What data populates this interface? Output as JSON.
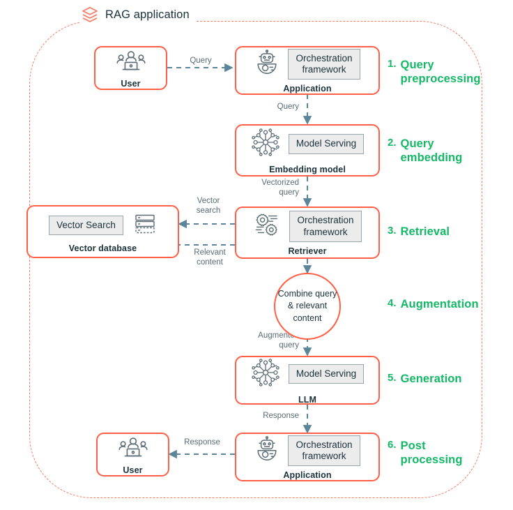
{
  "diagram": {
    "title": "RAG application",
    "title_icon": "layers-icon",
    "boundary_style": "dashed-rounded",
    "colors": {
      "node_border": "#ff5f46",
      "boundary": "#f4664a",
      "step_label": "#14b866",
      "arrow": "#5b8699",
      "chip_fill": "#ececec",
      "text": "#1b3139",
      "edge_label": "#5a6b73"
    }
  },
  "nodes": {
    "user_top": {
      "label": "User",
      "icon": "users-group-icon"
    },
    "application_top": {
      "label": "Application",
      "icon": "robot-icon",
      "chip": "Orchestration\nframework"
    },
    "embedding_model": {
      "label": "Embedding model",
      "icon": "neural-network-icon",
      "chip": "Model Serving"
    },
    "vector_database": {
      "label": "Vector database",
      "icon": "database-stack-icon",
      "chip": "Vector Search"
    },
    "retriever": {
      "label": "Retriever",
      "icon": "gears-icon",
      "chip": "Orchestration\nframework"
    },
    "combine": {
      "text": "Combine\nquery &\nrelevant\ncontent"
    },
    "llm": {
      "label": "LLM",
      "icon": "neural-network-icon",
      "chip": "Model Serving"
    },
    "application_bottom": {
      "label": "Application",
      "icon": "robot-icon",
      "chip": "Orchestration\nframework"
    },
    "user_bottom": {
      "label": "User",
      "icon": "users-group-icon"
    }
  },
  "edges": {
    "user_to_app": "Query",
    "app_to_embedding": "Query",
    "embedding_to_retriever": "Vectorized\nquery",
    "retriever_to_vectordb": "Vector\nsearch",
    "vectordb_to_retriever": "Relevant\ncontent",
    "retriever_to_combine": "",
    "combine_to_llm": "Augmented\nquery",
    "llm_to_app": "Response",
    "app_to_user": "Response"
  },
  "steps": [
    {
      "num": "1.",
      "text": "Query\npreprocessing"
    },
    {
      "num": "2.",
      "text": "Query\nembedding"
    },
    {
      "num": "3.",
      "text": "Retrieval"
    },
    {
      "num": "4.",
      "text": "Augmentation"
    },
    {
      "num": "5.",
      "text": "Generation"
    },
    {
      "num": "6.",
      "text": "Post\nprocessing"
    }
  ]
}
